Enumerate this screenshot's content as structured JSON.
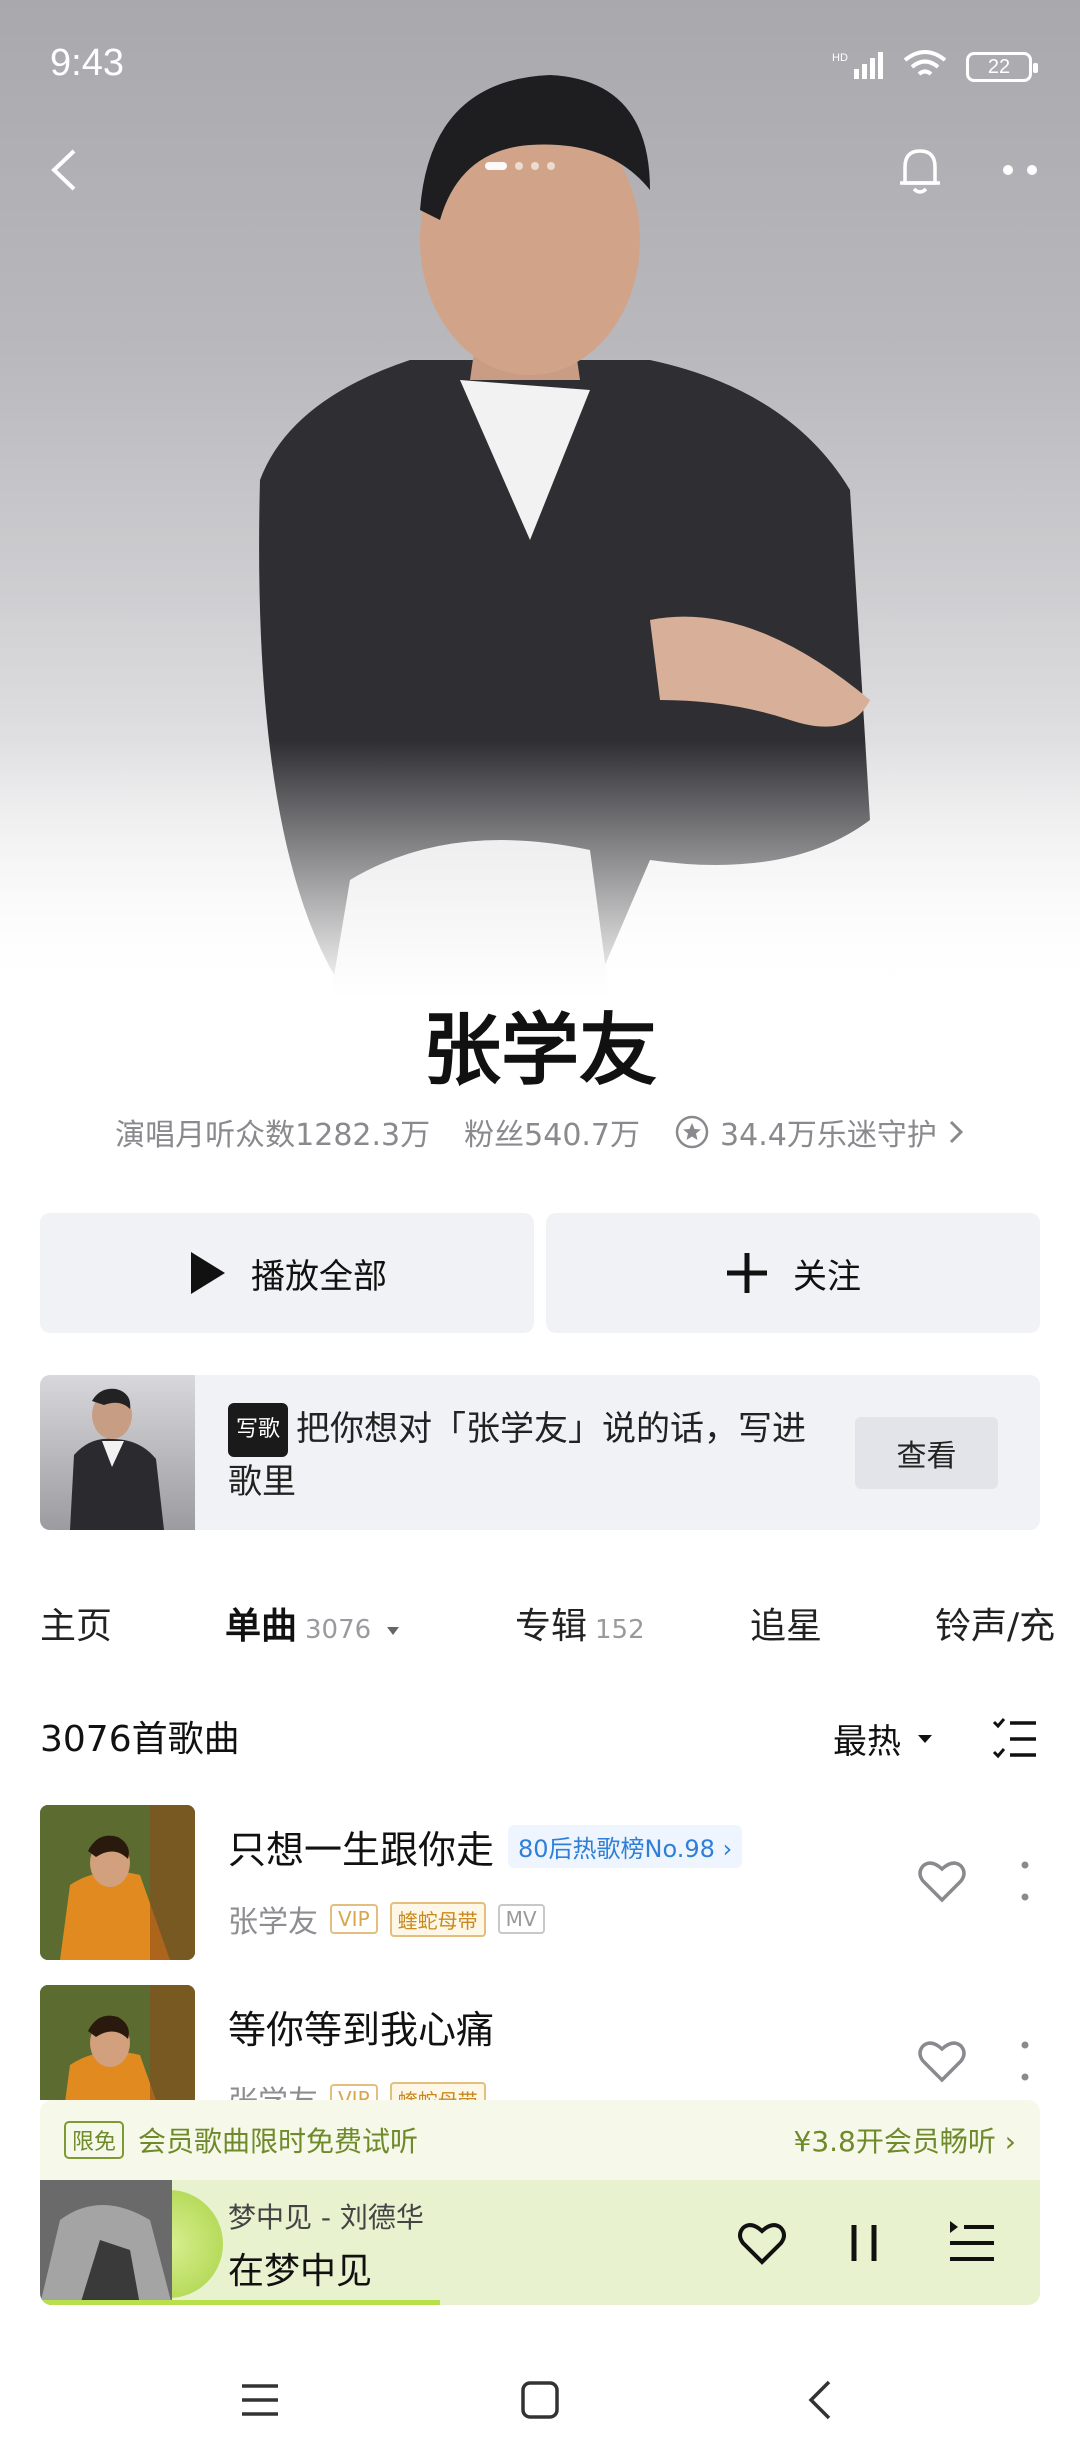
{
  "status": {
    "time": "9:43",
    "battery": "22",
    "network": "HD"
  },
  "artist": {
    "name": "张学友",
    "monthly_listeners": "演唱月听众数1282.3万",
    "fans": "粉丝540.7万",
    "guardians": "34.4万乐迷守护"
  },
  "actions": {
    "play_all": "播放全部",
    "follow": "关注"
  },
  "banner": {
    "tag": "写歌",
    "text": "把你想对「张学友」说的话，写进歌里",
    "button": "查看"
  },
  "tabs": [
    {
      "label": "主页",
      "count": ""
    },
    {
      "label": "单曲",
      "count": "3076"
    },
    {
      "label": "专辑",
      "count": "152"
    },
    {
      "label": "追星",
      "count": ""
    },
    {
      "label": "铃声/充",
      "count": ""
    }
  ],
  "song_list": {
    "count_label": "3076首歌曲",
    "sort_label": "最热",
    "songs": [
      {
        "title": "只想一生跟你走",
        "rank": "80后热歌榜No.98",
        "artist": "张学友",
        "badges": [
          "VIP",
          "蝰蛇母带",
          "MV"
        ]
      },
      {
        "title": "等你等到我心痛",
        "rank": "",
        "artist": "张学友",
        "badges": [
          "VIP",
          "蝰蛇母带"
        ]
      }
    ]
  },
  "trial": {
    "tag": "限免",
    "text": "会员歌曲限时免费试听",
    "cta": "¥3.8开会员畅听"
  },
  "player": {
    "subtitle": "梦中见 - 刘德华",
    "title": "在梦中见",
    "progress": 0.4
  },
  "colors": {
    "accent_green": "#b8e04a",
    "rank_blue": "#2f7fd8",
    "vip_gold": "#d9a64a"
  }
}
